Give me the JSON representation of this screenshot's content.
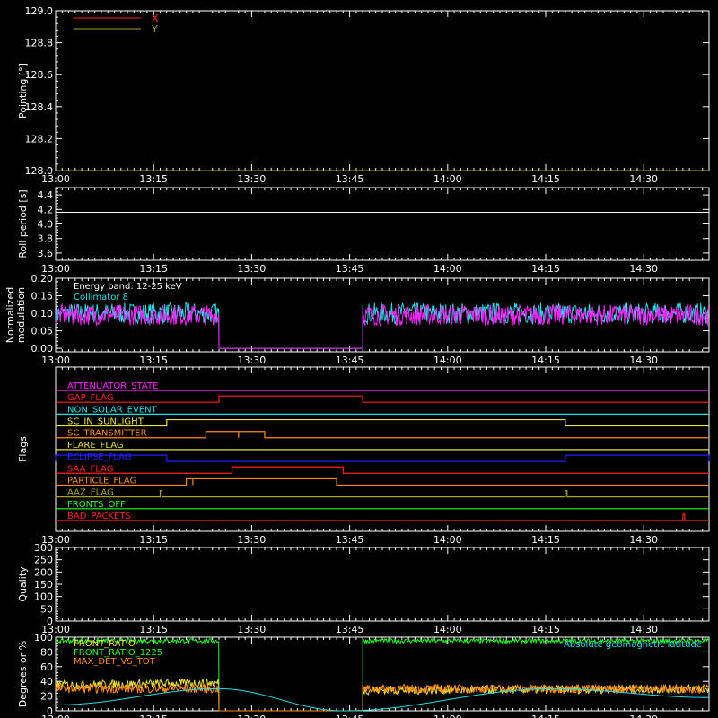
{
  "colors": {
    "background": "#000000",
    "axes": "#ffffff",
    "red": "#ff2020",
    "orange": "#ff8c10",
    "yellow": "#e8e040",
    "cyan": "#20e0e8",
    "magenta": "#ff20ff",
    "green": "#20ff20",
    "blue": "#2020ff",
    "olive": "#a8a020"
  },
  "time_axis": {
    "ticks": [
      "13:00",
      "13:15",
      "13:30",
      "13:45",
      "14:00",
      "14:15",
      "14:30"
    ],
    "range": [
      "13:00",
      "14:40"
    ]
  },
  "chart_data": [
    {
      "id": "pointing",
      "type": "line",
      "ylabel": "Pointing [°]",
      "ylim": [
        128.0,
        129.0
      ],
      "yticks": [
        "128.0",
        "128.2",
        "128.4",
        "128.6",
        "128.8",
        "129.0"
      ],
      "legend": [
        {
          "label": "X",
          "color": "red"
        },
        {
          "label": "Y",
          "color": "olive"
        }
      ],
      "series": [
        {
          "name": "X",
          "color": "red",
          "x": [
            "13:00",
            "14:40"
          ],
          "y": [
            128.0,
            128.0
          ]
        },
        {
          "name": "Y",
          "color": "olive",
          "x": [
            "13:00",
            "14:40"
          ],
          "y": [
            128.0,
            128.0
          ]
        }
      ]
    },
    {
      "id": "roll",
      "type": "line",
      "ylabel": "Roll period [s]",
      "ylim": [
        3.5,
        4.5
      ],
      "yticks": [
        "3.6",
        "3.8",
        "4.0",
        "4.2",
        "4.4"
      ],
      "series": [
        {
          "color": "axes",
          "x": [
            "13:00",
            "14:40"
          ],
          "y": [
            4.16,
            4.16
          ]
        }
      ]
    },
    {
      "id": "modulation",
      "type": "line",
      "ylabel": "Normalized modulation",
      "ylim": [
        -0.01,
        0.2
      ],
      "yticks": [
        "0.00",
        "0.05",
        "0.10",
        "0.15",
        "0.20"
      ],
      "legend": [
        {
          "label": "Energy band: 12-25 keV",
          "color": "axes"
        },
        {
          "label": "Collimator 8",
          "color": "cyan"
        }
      ],
      "series": [
        {
          "color": "cyan",
          "x": [
            "13:00",
            "13:25",
            "13:25",
            "13:47",
            "13:47",
            "14:40"
          ],
          "y": [
            0.1,
            0.1,
            0.0,
            0.0,
            0.1,
            0.1
          ]
        },
        {
          "color": "magenta",
          "x": [
            "13:00",
            "13:25",
            "13:25",
            "13:47",
            "13:47",
            "14:40"
          ],
          "y": [
            0.095,
            0.095,
            0.0,
            0.0,
            0.095,
            0.095
          ]
        }
      ]
    },
    {
      "id": "flags",
      "type": "line",
      "ylabel": "Flags",
      "flags": [
        {
          "name": "ATTENUATOR_STATE",
          "color": "magenta",
          "on": []
        },
        {
          "name": "GAP_FLAG",
          "color": "red",
          "on": [
            [
              "13:25",
              "13:47"
            ]
          ]
        },
        {
          "name": "NON_SOLAR_EVENT",
          "color": "cyan",
          "on": []
        },
        {
          "name": "SC_IN_SUNLIGHT",
          "color": "yellow",
          "on": [
            [
              "13:17",
              "14:18"
            ]
          ]
        },
        {
          "name": "SC_TRANSMITTER",
          "color": "orange",
          "on": [
            [
              "13:23",
              "13:28"
            ],
            [
              "13:28",
              "13:32"
            ]
          ]
        },
        {
          "name": "FLARE_FLAG",
          "color": "yellow",
          "on": []
        },
        {
          "name": "ECLIPSE_FLAG",
          "color": "blue",
          "on": [
            [
              "13:00",
              "13:17"
            ],
            [
              "14:18",
              "14:40"
            ]
          ]
        },
        {
          "name": "SAA_FLAG",
          "color": "red",
          "on": [
            [
              "13:27",
              "13:44"
            ]
          ]
        },
        {
          "name": "PARTICLE_FLAG",
          "color": "orange",
          "on": [
            [
              "13:20",
              "13:21"
            ],
            [
              "13:21",
              "13:43"
            ]
          ]
        },
        {
          "name": "AAZ_FLAG",
          "color": "olive",
          "on": [
            [
              "13:16",
              "13:16"
            ],
            [
              "14:18",
              "14:18"
            ]
          ]
        },
        {
          "name": "FRONTS_OFF",
          "color": "green",
          "on": []
        },
        {
          "name": "BAD_PACKETS",
          "color": "red",
          "on": [
            [
              "14:36",
              "14:36"
            ]
          ]
        }
      ]
    },
    {
      "id": "quality",
      "type": "line",
      "ylabel": "Quality",
      "ylim": [
        0,
        300
      ],
      "yticks": [
        "0",
        "50",
        "100",
        "150",
        "200",
        "250",
        "300"
      ],
      "series": []
    },
    {
      "id": "ratios",
      "type": "line",
      "ylabel": "Degrees or %",
      "ylim": [
        0,
        100
      ],
      "yticks": [
        "0",
        "20",
        "40",
        "60",
        "80",
        "100"
      ],
      "legend": [
        {
          "label": "FRONT_RATIO",
          "color": "yellow"
        },
        {
          "label": "FRONT_RATIO_1225",
          "color": "green"
        },
        {
          "label": "MAX_DET_VS_TOT",
          "color": "orange"
        }
      ],
      "annotation": "Absolute geomagnetic latitude",
      "series": [
        {
          "name": "FRONT_RATIO_1225",
          "color": "green",
          "x": [
            "13:00",
            "13:25",
            "13:25",
            "13:47",
            "13:47",
            "14:40"
          ],
          "y": [
            95,
            95,
            0,
            0,
            95,
            95
          ]
        },
        {
          "name": "FRONT_RATIO",
          "color": "yellow",
          "x": [
            "13:00",
            "13:25",
            "13:25",
            "13:47",
            "13:47",
            "14:40"
          ],
          "y": [
            35,
            38,
            0,
            0,
            28,
            30
          ]
        },
        {
          "name": "MAX_DET_VS_TOT",
          "color": "orange",
          "x": [
            "13:00",
            "13:25",
            "13:25",
            "13:47",
            "13:47",
            "14:40"
          ],
          "y": [
            30,
            30,
            0,
            0,
            30,
            30
          ]
        },
        {
          "name": "Absolute geomagnetic latitude",
          "color": "cyan",
          "x": [
            "13:00",
            "13:25",
            "13:44",
            "14:16",
            "14:40"
          ],
          "y": [
            8,
            30,
            0,
            30,
            18
          ]
        }
      ]
    }
  ]
}
